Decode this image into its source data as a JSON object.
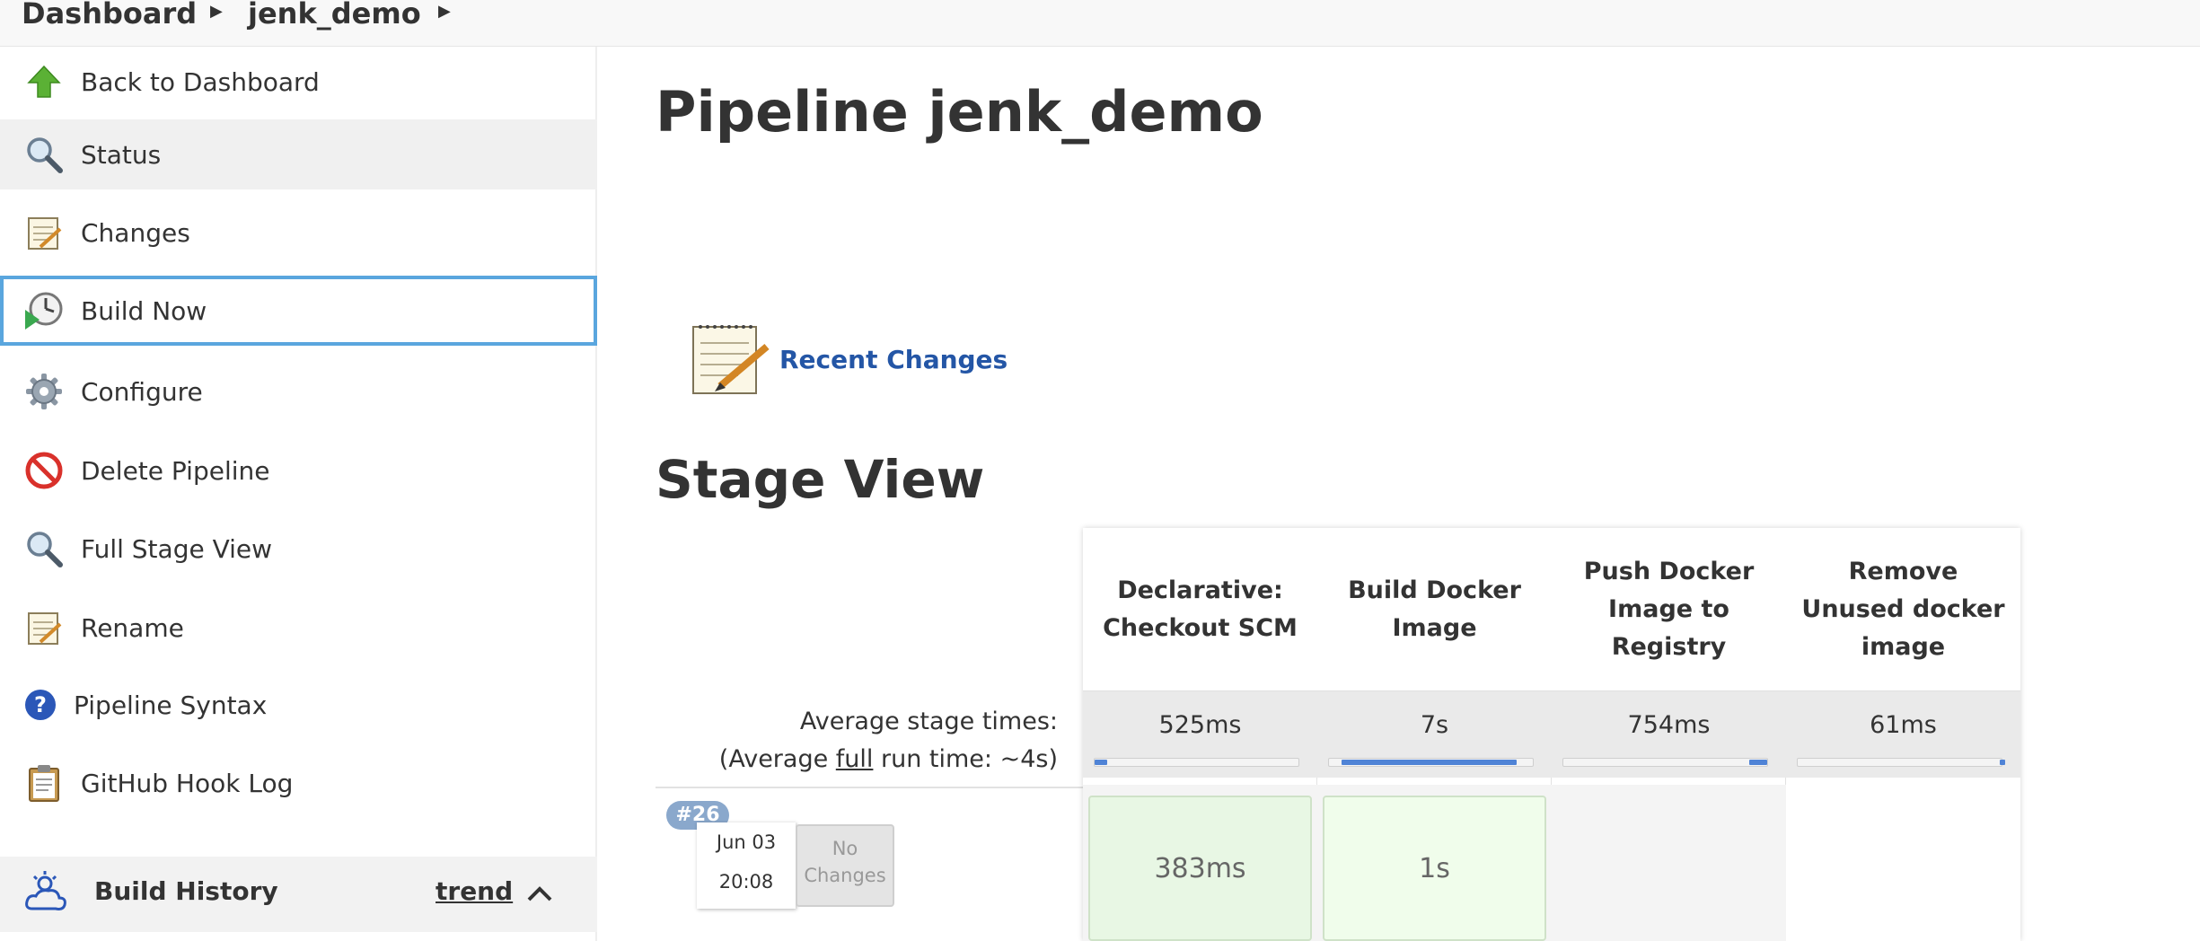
{
  "breadcrumb": {
    "items": [
      "Dashboard",
      "jenk_demo"
    ]
  },
  "sidebar": {
    "items": [
      {
        "label": "Back to Dashboard",
        "icon": "up-arrow-icon"
      },
      {
        "label": "Status",
        "icon": "search-icon"
      },
      {
        "label": "Changes",
        "icon": "notepad-icon"
      },
      {
        "label": "Build Now",
        "icon": "clock-play-icon"
      },
      {
        "label": "Configure",
        "icon": "gear-icon"
      },
      {
        "label": "Delete Pipeline",
        "icon": "no-entry-icon"
      },
      {
        "label": "Full Stage View",
        "icon": "search-icon"
      },
      {
        "label": "Rename",
        "icon": "notepad-icon"
      },
      {
        "label": "Pipeline Syntax",
        "icon": "help-icon"
      },
      {
        "label": "GitHub Hook Log",
        "icon": "clipboard-icon"
      }
    ],
    "build_history": {
      "title": "Build History",
      "trend": "trend"
    }
  },
  "main": {
    "title": "Pipeline jenk_demo",
    "recent_changes": "Recent Changes",
    "stage_view_title": "Stage View",
    "avg_stage_times": "Average stage times:",
    "avg_run_prefix": "(Average ",
    "avg_run_link": "full",
    "avg_run_suffix": " run time: ~4s)",
    "stages": [
      {
        "name": "Declarative: Checkout SCM",
        "avg": "525ms",
        "progress_start": 0.0,
        "progress_end": 0.06
      },
      {
        "name": "Build Docker Image",
        "avg": "7s",
        "progress_start": 0.06,
        "progress_end": 0.92
      },
      {
        "name": "Push Docker Image to Registry",
        "avg": "754ms",
        "progress_start": 0.91,
        "progress_end": 1.0
      },
      {
        "name": "Remove Unused docker image",
        "avg": "61ms",
        "progress_start": 0.99,
        "progress_end": 1.0
      }
    ],
    "build": {
      "number": "#26",
      "date": "Jun 03",
      "time": "20:08",
      "changes_line1": "No",
      "changes_line2": "Changes",
      "stage_results": [
        "383ms",
        "1s",
        "",
        ""
      ]
    }
  },
  "colors": {
    "link": "#2456a6",
    "focus": "#5aa6de",
    "progress": "#4f83d6",
    "success_cell": "#e8f7e4"
  }
}
